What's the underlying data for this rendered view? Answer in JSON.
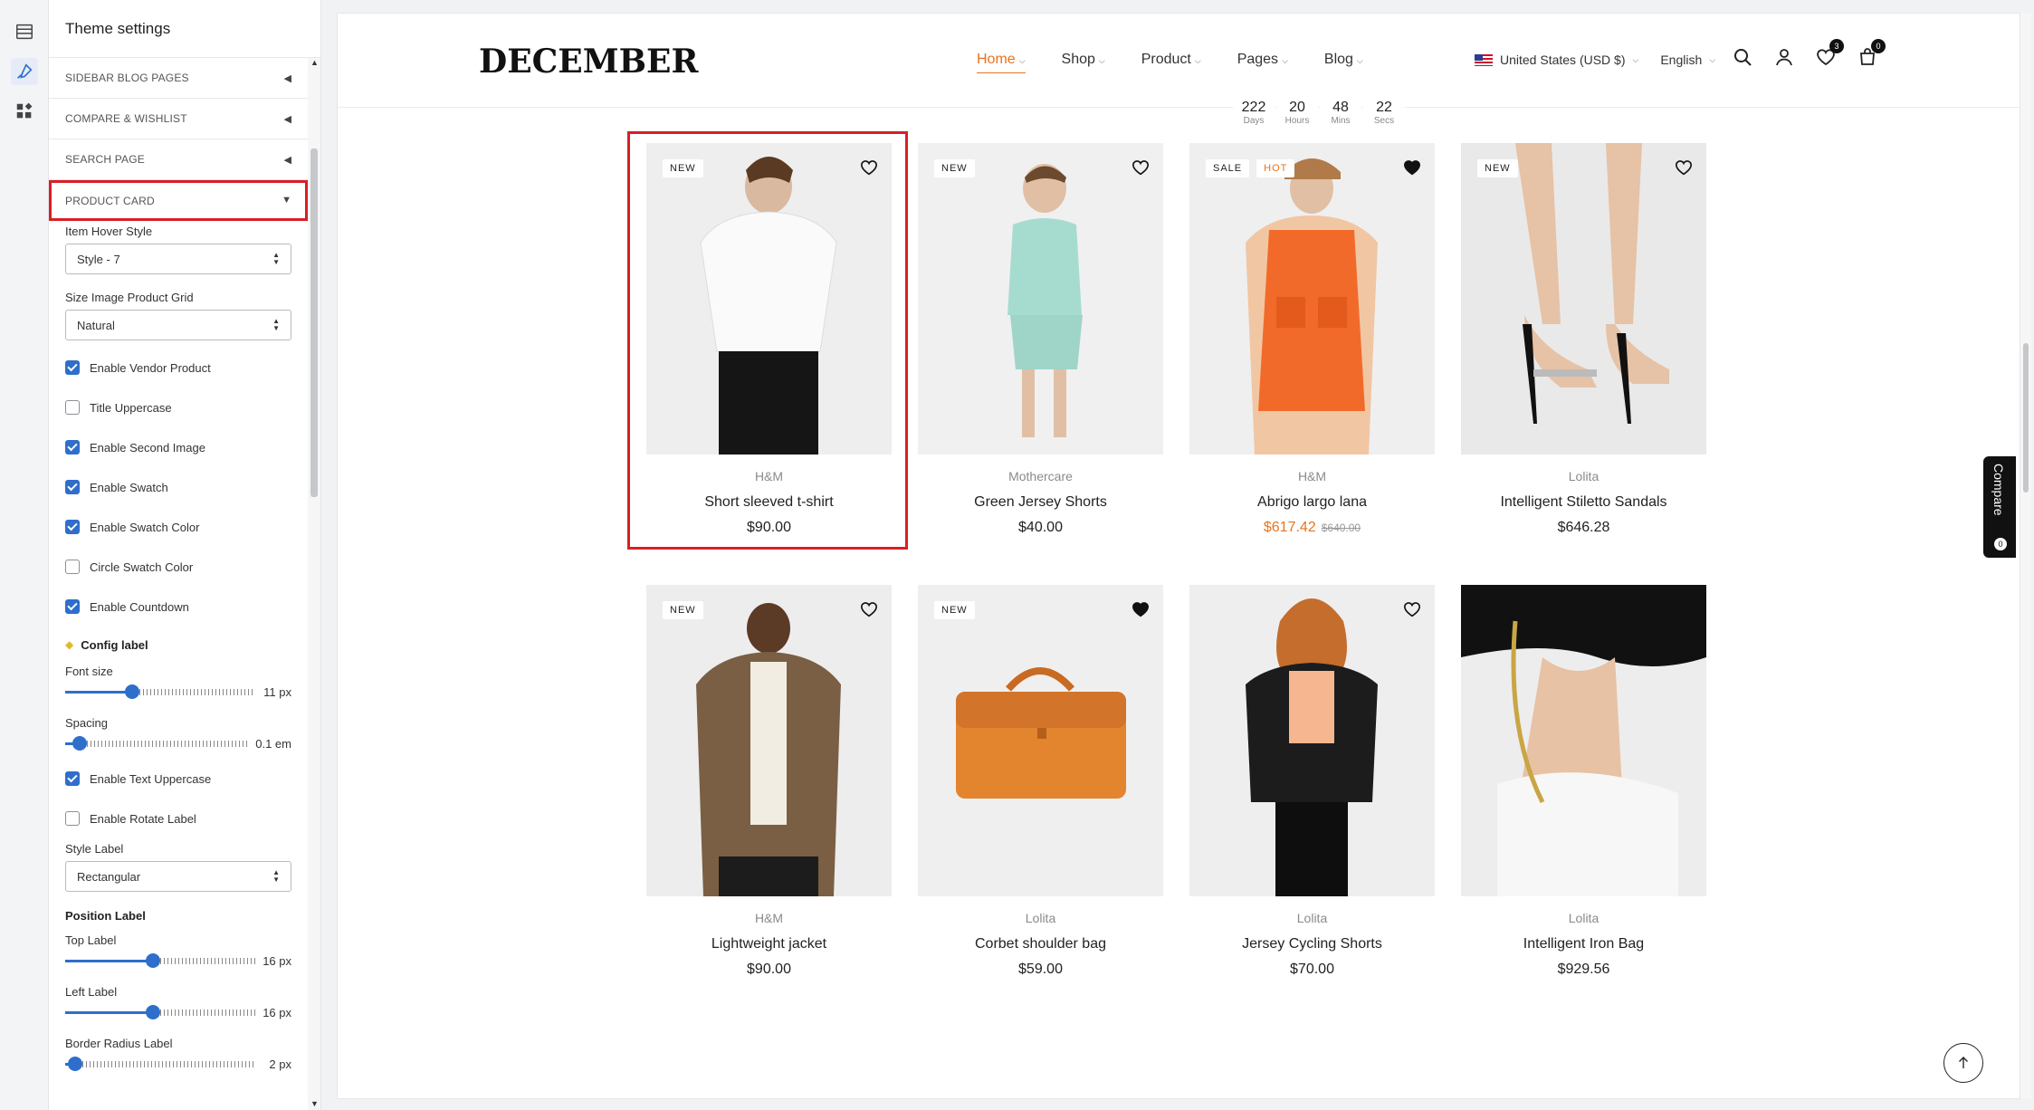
{
  "panel": {
    "title": "Theme settings",
    "sections": [
      {
        "label": "SIDEBAR BLOG PAGES"
      },
      {
        "label": "COMPARE & WISHLIST"
      },
      {
        "label": "SEARCH PAGE"
      },
      {
        "label": "PRODUCT CARD"
      }
    ],
    "item_hover_style": {
      "label": "Item Hover Style",
      "value": "Style - 7"
    },
    "size_image": {
      "label": "Size Image Product Grid",
      "value": "Natural"
    },
    "checks": [
      {
        "label": "Enable Vendor Product",
        "checked": true
      },
      {
        "label": "Title Uppercase",
        "checked": false
      },
      {
        "label": "Enable Second Image",
        "checked": true
      },
      {
        "label": "Enable Swatch",
        "checked": true
      },
      {
        "label": "Enable Swatch Color",
        "checked": true
      },
      {
        "label": "Circle Swatch Color",
        "checked": false
      },
      {
        "label": "Enable Countdown",
        "checked": true
      }
    ],
    "config_label": "Config label",
    "font_size": {
      "label": "Font size",
      "value": "11 px",
      "level": 0.35
    },
    "spacing": {
      "label": "Spacing",
      "value": "0.1 em",
      "level": 0.08
    },
    "checks2": [
      {
        "label": "Enable Text Uppercase",
        "checked": true
      },
      {
        "label": "Enable Rotate Label",
        "checked": false
      }
    ],
    "style_label": {
      "label": "Style Label",
      "value": "Rectangular"
    },
    "position_label": "Position Label",
    "top_label": {
      "label": "Top Label",
      "value": "16 px",
      "level": 0.46
    },
    "left_label": {
      "label": "Left Label",
      "value": "16 px",
      "level": 0.46
    },
    "border_radius": {
      "label": "Border Radius Label",
      "value": "2 px",
      "level": 0.05
    }
  },
  "site": {
    "logo": "DECEMBER",
    "nav": [
      {
        "label": "Home"
      },
      {
        "label": "Shop"
      },
      {
        "label": "Product"
      },
      {
        "label": "Pages"
      },
      {
        "label": "Blog"
      }
    ],
    "currency": "United States (USD $)",
    "language": "English",
    "wishlist_count": "3",
    "cart_count": "0",
    "compare_label": "Compare",
    "compare_count": "0"
  },
  "products": [
    {
      "vendor": "H&M",
      "title": "Short sleeved t-shirt",
      "price": "$90.00",
      "labels": [
        "NEW"
      ],
      "wished": false
    },
    {
      "vendor": "Mothercare",
      "title": "Green Jersey Shorts",
      "price": "$40.00",
      "labels": [
        "NEW"
      ],
      "wished": false
    },
    {
      "vendor": "H&M",
      "title": "Abrigo largo lana",
      "price": "$617.42",
      "old_price": "$640.00",
      "labels": [
        "SALE",
        "HOT"
      ],
      "wished": true,
      "countdown": [
        {
          "n": "222",
          "u": "Days"
        },
        {
          "n": "20",
          "u": "Hours"
        },
        {
          "n": "48",
          "u": "Mins"
        },
        {
          "n": "22",
          "u": "Secs"
        }
      ]
    },
    {
      "vendor": "Lolita",
      "title": "Intelligent Stiletto Sandals",
      "price": "$646.28",
      "labels": [
        "NEW"
      ],
      "wished": false
    },
    {
      "vendor": "H&M",
      "title": "Lightweight jacket",
      "price": "$90.00",
      "labels": [
        "NEW"
      ],
      "wished": false
    },
    {
      "vendor": "Lolita",
      "title": "Corbet shoulder bag",
      "price": "$59.00",
      "labels": [
        "NEW"
      ],
      "wished": true
    },
    {
      "vendor": "Lolita",
      "title": "Jersey Cycling Shorts",
      "price": "$70.00",
      "labels": [],
      "wished": false
    },
    {
      "vendor": "Lolita",
      "title": "Intelligent Iron Bag",
      "price": "$929.56",
      "labels": [],
      "wished": false
    }
  ],
  "colors": {
    "accent": "#e8731f",
    "check": "#2f6ecb",
    "highlight": "#d81f26"
  }
}
